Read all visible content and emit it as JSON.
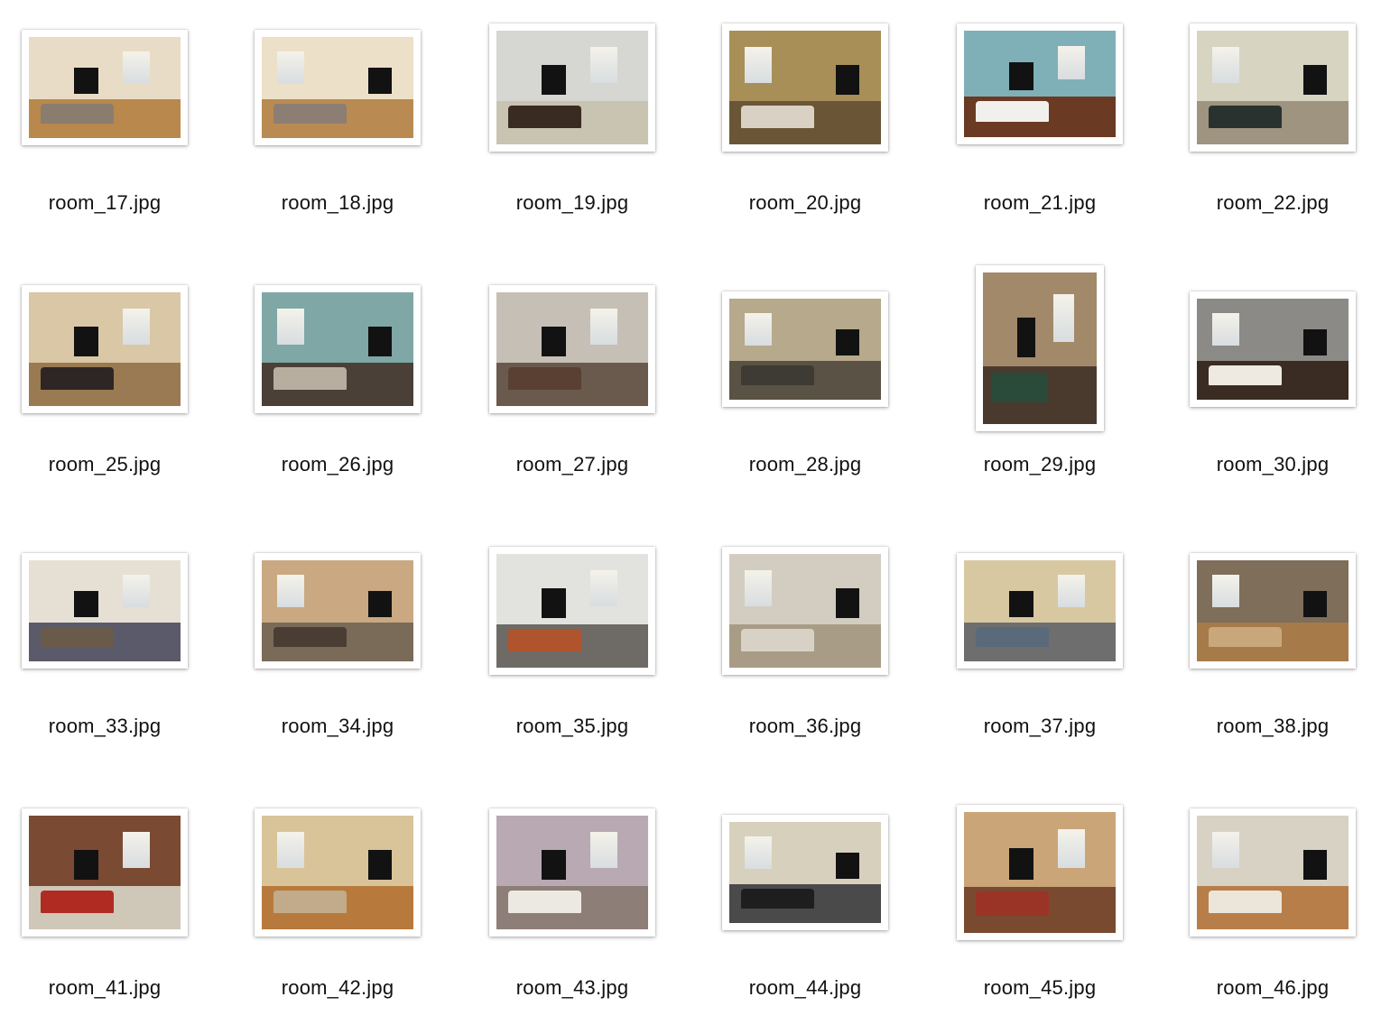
{
  "files": [
    {
      "name": "room_17.jpg",
      "wall": "#e8dcc6",
      "floor": "#b8884c",
      "sofa": "#8a7d70"
    },
    {
      "name": "room_18.jpg",
      "wall": "#ece0c8",
      "floor": "#b98b52",
      "sofa": "#8c7e72"
    },
    {
      "name": "room_19.jpg",
      "wall": "#d6d6d2",
      "floor": "#c9c3b2",
      "sofa": "#3a2b22"
    },
    {
      "name": "room_20.jpg",
      "wall": "#a88f58",
      "floor": "#6a5536",
      "sofa": "#d9d2c4"
    },
    {
      "name": "room_21.jpg",
      "wall": "#7fb0b8",
      "floor": "#6b3a22",
      "sofa": "#f2f0ec"
    },
    {
      "name": "room_22.jpg",
      "wall": "#d8d4c2",
      "floor": "#9e9480",
      "sofa": "#2a3230"
    },
    {
      "name": "room_25.jpg",
      "wall": "#d9c7a6",
      "floor": "#9a7a52",
      "sofa": "#2e2624"
    },
    {
      "name": "room_26.jpg",
      "wall": "#7fa7a6",
      "floor": "#4a4038",
      "sofa": "#b8aea0"
    },
    {
      "name": "room_27.jpg",
      "wall": "#c6bfb6",
      "floor": "#6a5a4e",
      "sofa": "#5a4032"
    },
    {
      "name": "room_28.jpg",
      "wall": "#b6a98c",
      "floor": "#5a5244",
      "sofa": "#3e3a34"
    },
    {
      "name": "room_29.jpg",
      "wall": "#a2896a",
      "floor": "#4a3a2e",
      "sofa": "#2a4a3a"
    },
    {
      "name": "room_30.jpg",
      "wall": "#8c8a86",
      "floor": "#3a2c22",
      "sofa": "#eeeae2"
    },
    {
      "name": "room_33.jpg",
      "wall": "#e6e0d4",
      "floor": "#5a5a6a",
      "sofa": "#6a5a4a"
    },
    {
      "name": "room_34.jpg",
      "wall": "#c9a882",
      "floor": "#7a6a58",
      "sofa": "#4a3e34"
    },
    {
      "name": "room_35.jpg",
      "wall": "#e2e2de",
      "floor": "#6e6a66",
      "sofa": "#b0542e"
    },
    {
      "name": "room_36.jpg",
      "wall": "#d2cdc0",
      "floor": "#a89c86",
      "sofa": "#d8d2c6"
    },
    {
      "name": "room_37.jpg",
      "wall": "#d8c8a2",
      "floor": "#6e6e6e",
      "sofa": "#5a6a7a"
    },
    {
      "name": "room_38.jpg",
      "wall": "#7e6e5a",
      "floor": "#a77a4a",
      "sofa": "#c8a87a"
    },
    {
      "name": "room_41.jpg",
      "wall": "#7a4a32",
      "floor": "#cfc8b8",
      "sofa": "#b02c22"
    },
    {
      "name": "room_42.jpg",
      "wall": "#d9c49a",
      "floor": "#b87a3c",
      "sofa": "#c2ab8a"
    },
    {
      "name": "room_43.jpg",
      "wall": "#b8a9b3",
      "floor": "#8e7e78",
      "sofa": "#ece8e2"
    },
    {
      "name": "room_44.jpg",
      "wall": "#d7d0bc",
      "floor": "#4a4a4a",
      "sofa": "#1e1e1e"
    },
    {
      "name": "room_45.jpg",
      "wall": "#c9a578",
      "floor": "#7a4a30",
      "sofa": "#9a3426"
    },
    {
      "name": "room_46.jpg",
      "wall": "#d8d2c4",
      "floor": "#b87e4a",
      "sofa": "#ece6da"
    }
  ]
}
